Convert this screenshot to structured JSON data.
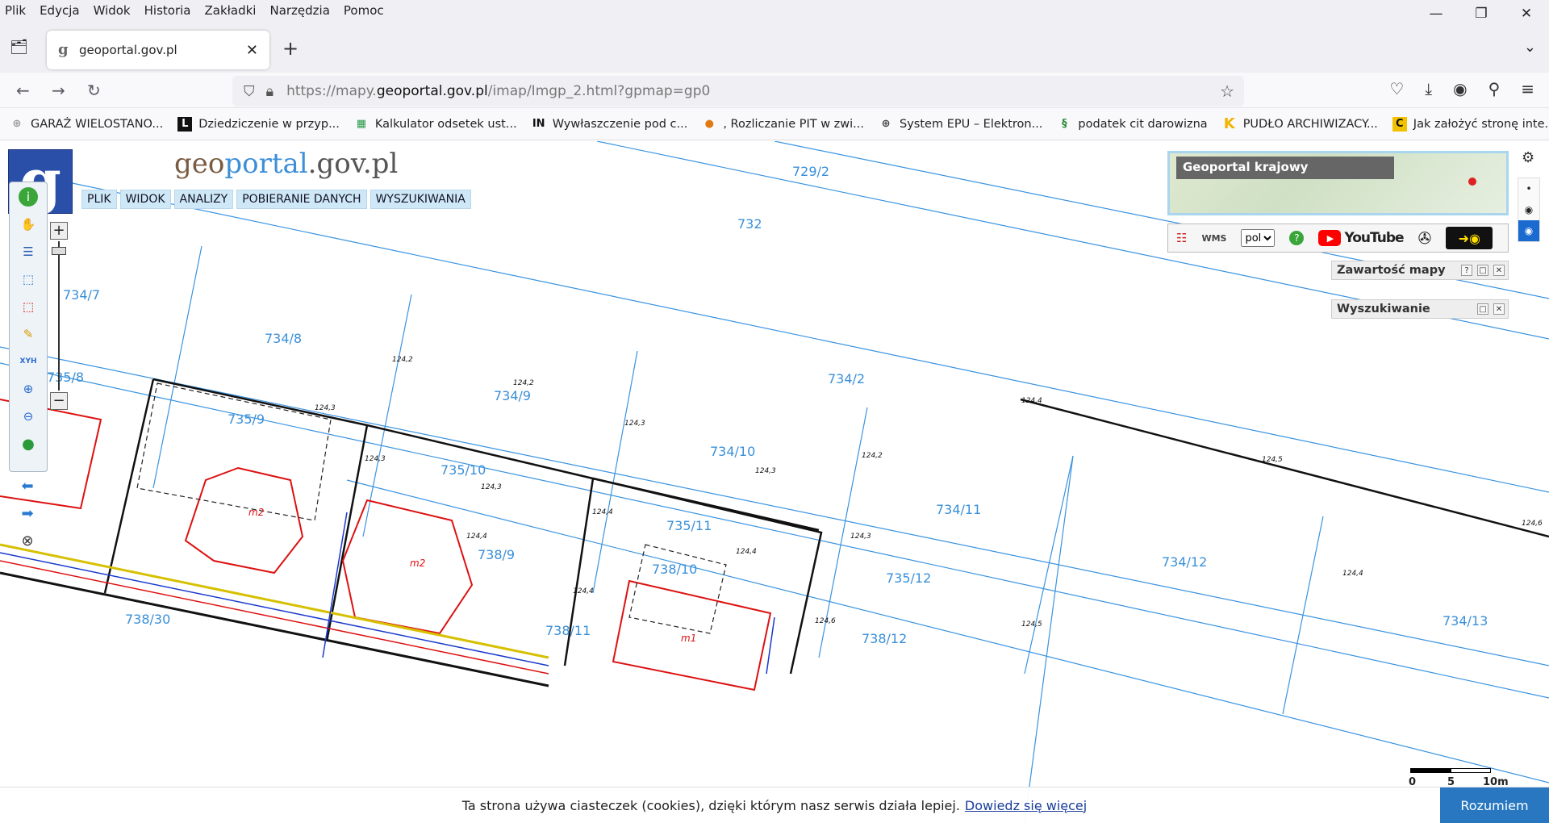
{
  "browser": {
    "menu": [
      "Plik",
      "Edycja",
      "Widok",
      "Historia",
      "Zakładki",
      "Narzędzia",
      "Pomoc"
    ],
    "tab_title": "geoportal.gov.pl",
    "url_prefix": "https://mapy.",
    "url_domain": "geoportal.gov.pl",
    "url_suffix": "/imap/Imgp_2.html?gpmap=gp0",
    "bookmarks": [
      {
        "label": "GARAŻ WIELOSTANO...",
        "icon": "puzzle-icon"
      },
      {
        "label": "Dziedziczenie w przyp...",
        "icon": "lex-icon"
      },
      {
        "label": "Kalkulator odsetek ust...",
        "icon": "calculator-icon"
      },
      {
        "label": "Wywłaszczenie pod c...",
        "icon": "in-icon"
      },
      {
        "label": ", Rozliczanie PIT w zwi...",
        "icon": "colorful-circle-icon"
      },
      {
        "label": "System EPU – Elektron...",
        "icon": "globe-icon"
      },
      {
        "label": "podatek cit darowizna",
        "icon": "paragraph-icon"
      },
      {
        "label": "PUDŁO ARCHIWIZACY...",
        "icon": "k-icon"
      },
      {
        "label": "Jak założyć stronę inte...",
        "icon": "c-icon"
      }
    ]
  },
  "app": {
    "logo_letter": "g",
    "title_geo": "geo",
    "title_portal": "portal",
    "title_rest": ".gov.pl",
    "menu": [
      "PLIK",
      "WIDOK",
      "ANALIZY",
      "POBIERANIE DANYCH",
      "WYSZUKIWANIA"
    ],
    "minimap_label": "Geoportal krajowy",
    "language": "pol",
    "youtube_label": "YouTube",
    "panels": [
      {
        "title": "Zawartość mapy"
      },
      {
        "title": "Wyszukiwanie"
      }
    ],
    "xyh_label": "XYH",
    "scale": {
      "labels": [
        "0",
        "5",
        "10m"
      ]
    }
  },
  "parcels": [
    "729/2",
    "732",
    "734/7",
    "734/8",
    "735/8",
    "734/9",
    "734/2",
    "735/9",
    "734/10",
    "735/10",
    "734/11",
    "735/11",
    "738/9",
    "734/12",
    "738/10",
    "735/12",
    "738/30",
    "738/12",
    "734/13",
    "738/11"
  ],
  "elevations": [
    "124,2",
    "124,2",
    "124,3",
    "124,3",
    "124,3",
    "124,3",
    "124,4",
    "124,2",
    "124,3",
    "124,4",
    "124,4",
    "124,4",
    "124,5",
    "124,6",
    "124,4",
    "124,5",
    "124,6",
    "124,3",
    "124,4"
  ],
  "buildings": [
    "m2",
    "m2",
    "m1"
  ],
  "cookie": {
    "text": "Ta strona używa ciasteczek (cookies), dzięki którym nasz serwis działa lepiej.",
    "link": "Dowiedz się więcej",
    "button": "Rozumiem"
  }
}
